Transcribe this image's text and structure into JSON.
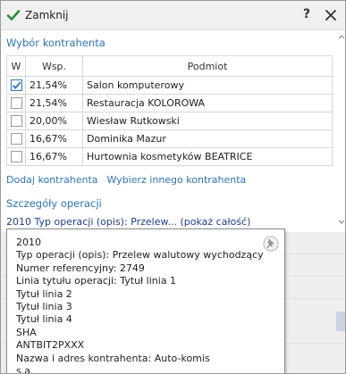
{
  "window": {
    "title": "Zamknij",
    "help_label": "?"
  },
  "contractor_section": {
    "title": "Wybór kontrahenta",
    "headers": {
      "w": "W",
      "wsp": "Wsp.",
      "podmiot": "Podmiot"
    },
    "rows": [
      {
        "checked": true,
        "wsp": "21,54%",
        "podmiot": "Salon komputerowy"
      },
      {
        "checked": false,
        "wsp": "21,54%",
        "podmiot": "Restauracja KOLOROWA"
      },
      {
        "checked": false,
        "wsp": "20,00%",
        "podmiot": "Wiesław Rutkowski"
      },
      {
        "checked": false,
        "wsp": "16,67%",
        "podmiot": "Dominika Mazur"
      },
      {
        "checked": false,
        "wsp": "16,67%",
        "podmiot": "Hurtownia kosmetyków BEATRICE"
      }
    ],
    "add_link": "Dodaj kontrahenta",
    "choose_other_link": "Wybierz innego kontrahenta"
  },
  "details_section": {
    "title": "Szczegóły operacji",
    "summary": "2010 Typ operacji (opis): Przelew...",
    "show_all": "(pokaż całość)"
  },
  "tooltip": {
    "lines": [
      "2010",
      "Typ operacji (opis): Przelew walutowy wychodzący",
      "Numer referencyjny: 2749",
      "Linia tytułu operacji: Tytuł linia 1",
      "Tytuł linia 2",
      "Tytuł linia 3",
      "Tytuł linia 4",
      "SHA",
      "ANTBIT2PXXX",
      "Nazwa i adres kontrahenta: Auto-komis",
      "s.a."
    ]
  },
  "colors": {
    "accent": "#2e74b5",
    "check": "#2e8b3a",
    "link_dark": "#1f3d8a"
  }
}
